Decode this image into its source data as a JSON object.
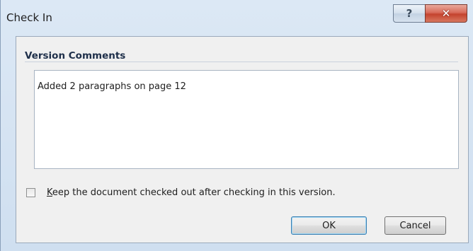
{
  "window": {
    "title": "Check In",
    "help_glyph": "?",
    "close_glyph": "✕"
  },
  "section": {
    "title": "Version Comments"
  },
  "comments": {
    "value": "Added 2 paragraphs on page 12"
  },
  "keep_checked_out": {
    "checked": false,
    "label_accel": "K",
    "label_rest": "eep the document checked out after checking in this version."
  },
  "buttons": {
    "ok": "OK",
    "cancel": "Cancel"
  },
  "icons": {
    "help": "help-icon",
    "close": "close-icon",
    "checkbox": "checkbox-unchecked"
  }
}
